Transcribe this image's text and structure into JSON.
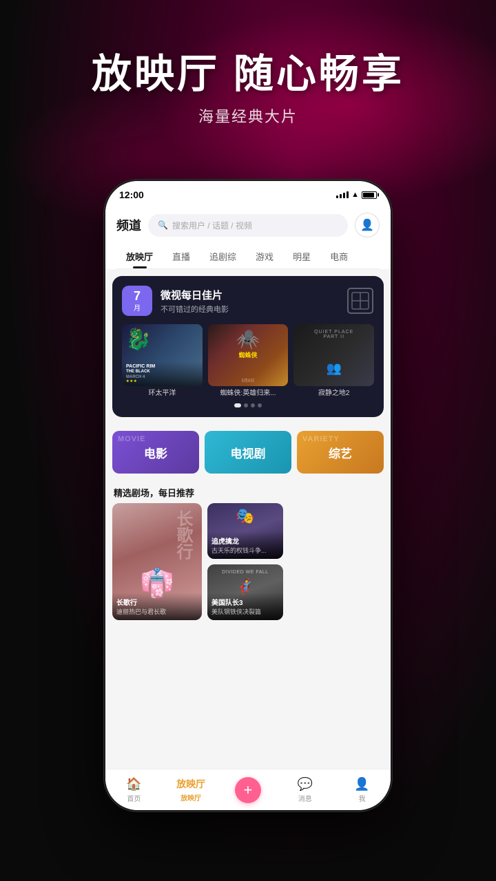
{
  "app": {
    "header_title": "放映厅 随心畅享",
    "header_subtitle": "海量经典大片"
  },
  "status_bar": {
    "time": "12:00"
  },
  "app_header": {
    "logo": "频道",
    "search_placeholder": "搜索用户 / 话题 / 视频"
  },
  "nav_tabs": {
    "items": [
      {
        "label": "放映厅",
        "active": true
      },
      {
        "label": "直播",
        "active": false
      },
      {
        "label": "追剧综",
        "active": false
      },
      {
        "label": "游戏",
        "active": false
      },
      {
        "label": "明星",
        "active": false
      },
      {
        "label": "电商",
        "active": false
      }
    ]
  },
  "featured_banner": {
    "date_num": "7",
    "date_unit": "月",
    "title": "微视每日佳片",
    "subtitle": "不可错过的经典电影",
    "movies": [
      {
        "title": "PACIFIC RIM\nTHE BLACK",
        "label": "环太平洋"
      },
      {
        "title": "蜘蛛侠",
        "label": "蜘蛛侠:英雄归来..."
      },
      {
        "title": "QUIET PLACE\nPART II",
        "label": "寂静之地2"
      }
    ]
  },
  "categories": [
    {
      "label": "电影",
      "type": "movies"
    },
    {
      "label": "电视剧",
      "type": "tv"
    },
    {
      "label": "综艺",
      "type": "variety"
    }
  ],
  "recommendations": {
    "section_title": "精选剧场，每日推荐",
    "items": [
      {
        "name": "长歌行",
        "desc": "迪丽热巴与君长歌",
        "size": "main"
      },
      {
        "name": "追虎擒龙",
        "desc": "古天乐的权钱斗争...",
        "size": "sm"
      },
      {
        "name": "美国队长3",
        "desc": "美队钢铁侠决裂篇",
        "size": "sm"
      }
    ]
  },
  "bottom_nav": {
    "items": [
      {
        "label": "首页",
        "active": false
      },
      {
        "label": "放映厅",
        "active": true
      },
      {
        "label": "+",
        "type": "plus"
      },
      {
        "label": "消息",
        "active": false
      },
      {
        "label": "我",
        "active": false
      }
    ]
  }
}
